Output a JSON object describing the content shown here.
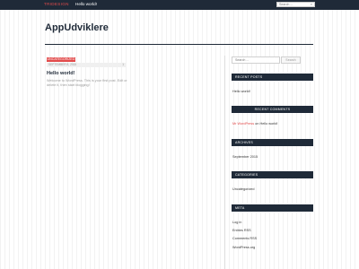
{
  "topbar": {
    "site_link": "TRIDESIGN",
    "nav_item": "Hello world!",
    "search_placeholder": "Search ...",
    "search_icon": "search-icon"
  },
  "header": {
    "title": "AppUdviklere"
  },
  "post": {
    "category": "UNCATEGORIZED",
    "date": "SEPTEMBER 8, 2015",
    "comments": "1",
    "title": "Hello world!",
    "excerpt": "Welcome to WordPress. This is your first post. Edit or delete it, then start blogging!"
  },
  "sidebar": {
    "search_placeholder": "Search ...",
    "search_button": "Search",
    "recent_posts": {
      "title": "RECENT POSTS",
      "items": [
        "Hello world!"
      ]
    },
    "recent_comments": {
      "title": "RECENT COMMENTS",
      "author": "Mr WordPress",
      "connector": " on ",
      "post": "Hello world!"
    },
    "archives": {
      "title": "ARCHIVES",
      "items": [
        "September 2015"
      ]
    },
    "categories": {
      "title": "CATEGORIES",
      "items": [
        "Uncategorized"
      ]
    },
    "meta": {
      "title": "META",
      "items": [
        "Log in",
        "Entries RSS",
        "Comments RSS",
        "WordPress.org"
      ]
    }
  },
  "colors": {
    "dark": "#1f2a38",
    "accent": "#e24b4b"
  }
}
